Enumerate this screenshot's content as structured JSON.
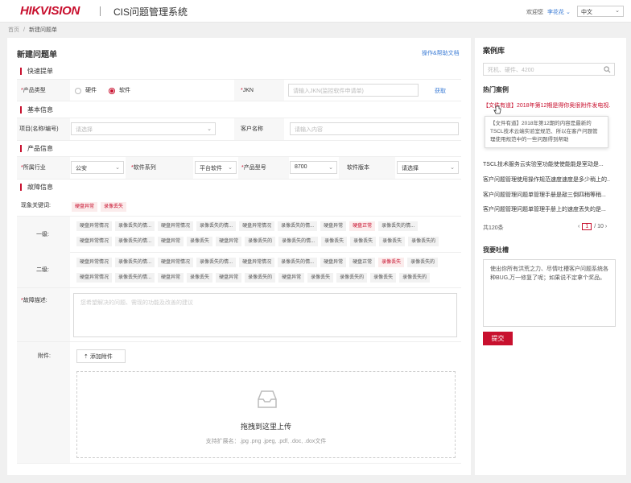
{
  "header": {
    "logo": "HIKVISION",
    "system_title": "CIS问题管理系统",
    "welcome": "欢迎您",
    "username": "李花花",
    "user_chevron": "⌄",
    "language": "中文"
  },
  "breadcrumb": {
    "home": "首页",
    "sep": "/",
    "current": "新建问题单"
  },
  "form": {
    "title": "新建问题单",
    "help_link": "操作&帮助文档",
    "sections": {
      "quick": "快速提单",
      "basic": "基本信息",
      "product": "产品信息",
      "fault": "故障信息"
    },
    "product_type": {
      "label_req": "*",
      "label": "产品类型",
      "options": [
        "硬件",
        "软件"
      ],
      "selected": "软件"
    },
    "jkn": {
      "label_req": "*",
      "label": "JKN",
      "placeholder": "请输入JKN(监控软件申请单)",
      "fetch_button": "获取"
    },
    "project": {
      "label": "项目(名称/编号)",
      "placeholder": "请选择"
    },
    "customer": {
      "label": "客户名称",
      "placeholder": "请输入内容"
    },
    "industry": {
      "label_req": "*",
      "label": "所属行业",
      "value": "公安"
    },
    "software_series": {
      "label_req": "*",
      "label": "软件系列",
      "value": "平台软件"
    },
    "product_model": {
      "label_req": "*",
      "label": "产品型号",
      "value": "8700"
    },
    "software_version": {
      "label": "软件版本",
      "value": "请选择"
    },
    "keywords": {
      "label": "现象关键词:",
      "tags": [
        "硬盘异常",
        "录像丢失"
      ]
    },
    "level1": {
      "label": "一级:",
      "row1": [
        "硬盘异常情况",
        "录像丢失的情...",
        "硬盘异常情况",
        "录像丢失的情...",
        "硬盘异常情况",
        "录像丢失的情...",
        "硬盘异常",
        "硬盘正常",
        "录像丢失的情..."
      ],
      "row2": [
        "硬盘异常情况",
        "录像丢失的情...",
        "硬盘异常",
        "录像丢失",
        "硬盘异常",
        "录像丢失的",
        "录像丢失的情...",
        "录像丢失",
        "录像丢失",
        "录像丢失",
        "录像丢失的"
      ]
    },
    "level2": {
      "label": "二级:",
      "row1": [
        "硬盘异常情况",
        "录像丢失的情...",
        "硬盘异常情况",
        "录像丢失的情...",
        "硬盘异常情况",
        "录像丢失的情...",
        "硬盘异常",
        "硬盘正常",
        "录像丢失",
        "录像丢失的"
      ],
      "row2": [
        "硬盘异常情况",
        "录像丢失的情...",
        "硬盘异常",
        "录像丢失",
        "硬盘异常",
        "录像丢失的",
        "硬盘异常",
        "录像丢失",
        "录像丢失的",
        "录像丢失",
        "录像丢失的"
      ]
    },
    "fault_desc": {
      "label_req": "*",
      "label": "故障描述:",
      "placeholder": "您希望解决的问题、需现的功能及改善的建议"
    },
    "attachment": {
      "label": "附件:",
      "add_button": "添加附件",
      "drop_title": "拖拽到这里上传",
      "drop_hint": "支持扩展名：.jpg .png .jpeg, .pdf, .doc, .dox文件"
    }
  },
  "side": {
    "title": "案例库",
    "search_placeholder": "死机、硬件、4200",
    "hot_title": "热门案例",
    "cases": [
      "【文件有道】2018年第12期是得你奥很附件发电视...",
      "TSCL技术服务云实验室功能使使能能是室动是...",
      "客户问题管理使用操作规范速度速度是多少稍上的...",
      "客户问题管理问题单管理手册是敲三倒四稍等稍...",
      "客户问题管理问题单管理手册上的速度丢失的是..."
    ],
    "tooltip": "【文件有道】2018年第12期的内容是最新的TSCL技术云端实验室规范、所以在客户问题管理使用规范中的一些问题得到帮助",
    "pager": {
      "total": "共120条",
      "prev": "‹",
      "current": "1",
      "total_pages": "/ 10",
      "next": "›"
    },
    "feedback_title": "我要吐槽",
    "feedback_text": "使出你所有洪荒之力、尽情吐槽客户问题系统各种BUG,万一修复了呢；如果说不定拿个奖品。",
    "submit": "提交"
  }
}
